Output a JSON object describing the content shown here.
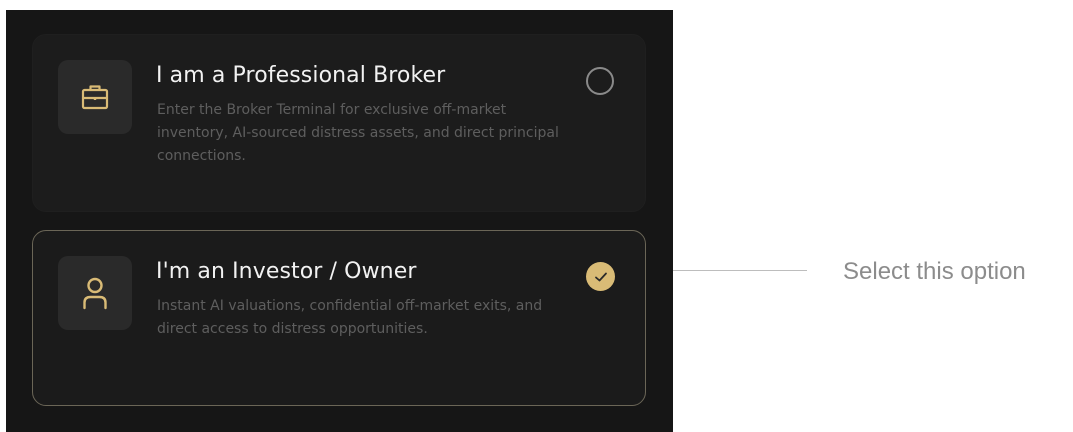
{
  "options": [
    {
      "title": "I am a Professional Broker",
      "description": "Enter the Broker Terminal for exclusive off-market inventory, AI-sourced distress assets, and direct principal connections.",
      "icon": "briefcase-icon",
      "selected": false
    },
    {
      "title": "I'm an Investor / Owner",
      "description": "Instant AI valuations, confidential off-market exits, and direct access to distress opportunities.",
      "icon": "user-icon",
      "selected": true
    }
  ],
  "annotation": {
    "text": "Select this option"
  },
  "colors": {
    "background": "#161616",
    "card": "#1c1c1c",
    "accent": "#d9bb76",
    "selected_border": "#6b6657",
    "title": "#f2f2f2",
    "description": "#5e5e5e",
    "icon": "#d9bb76"
  }
}
